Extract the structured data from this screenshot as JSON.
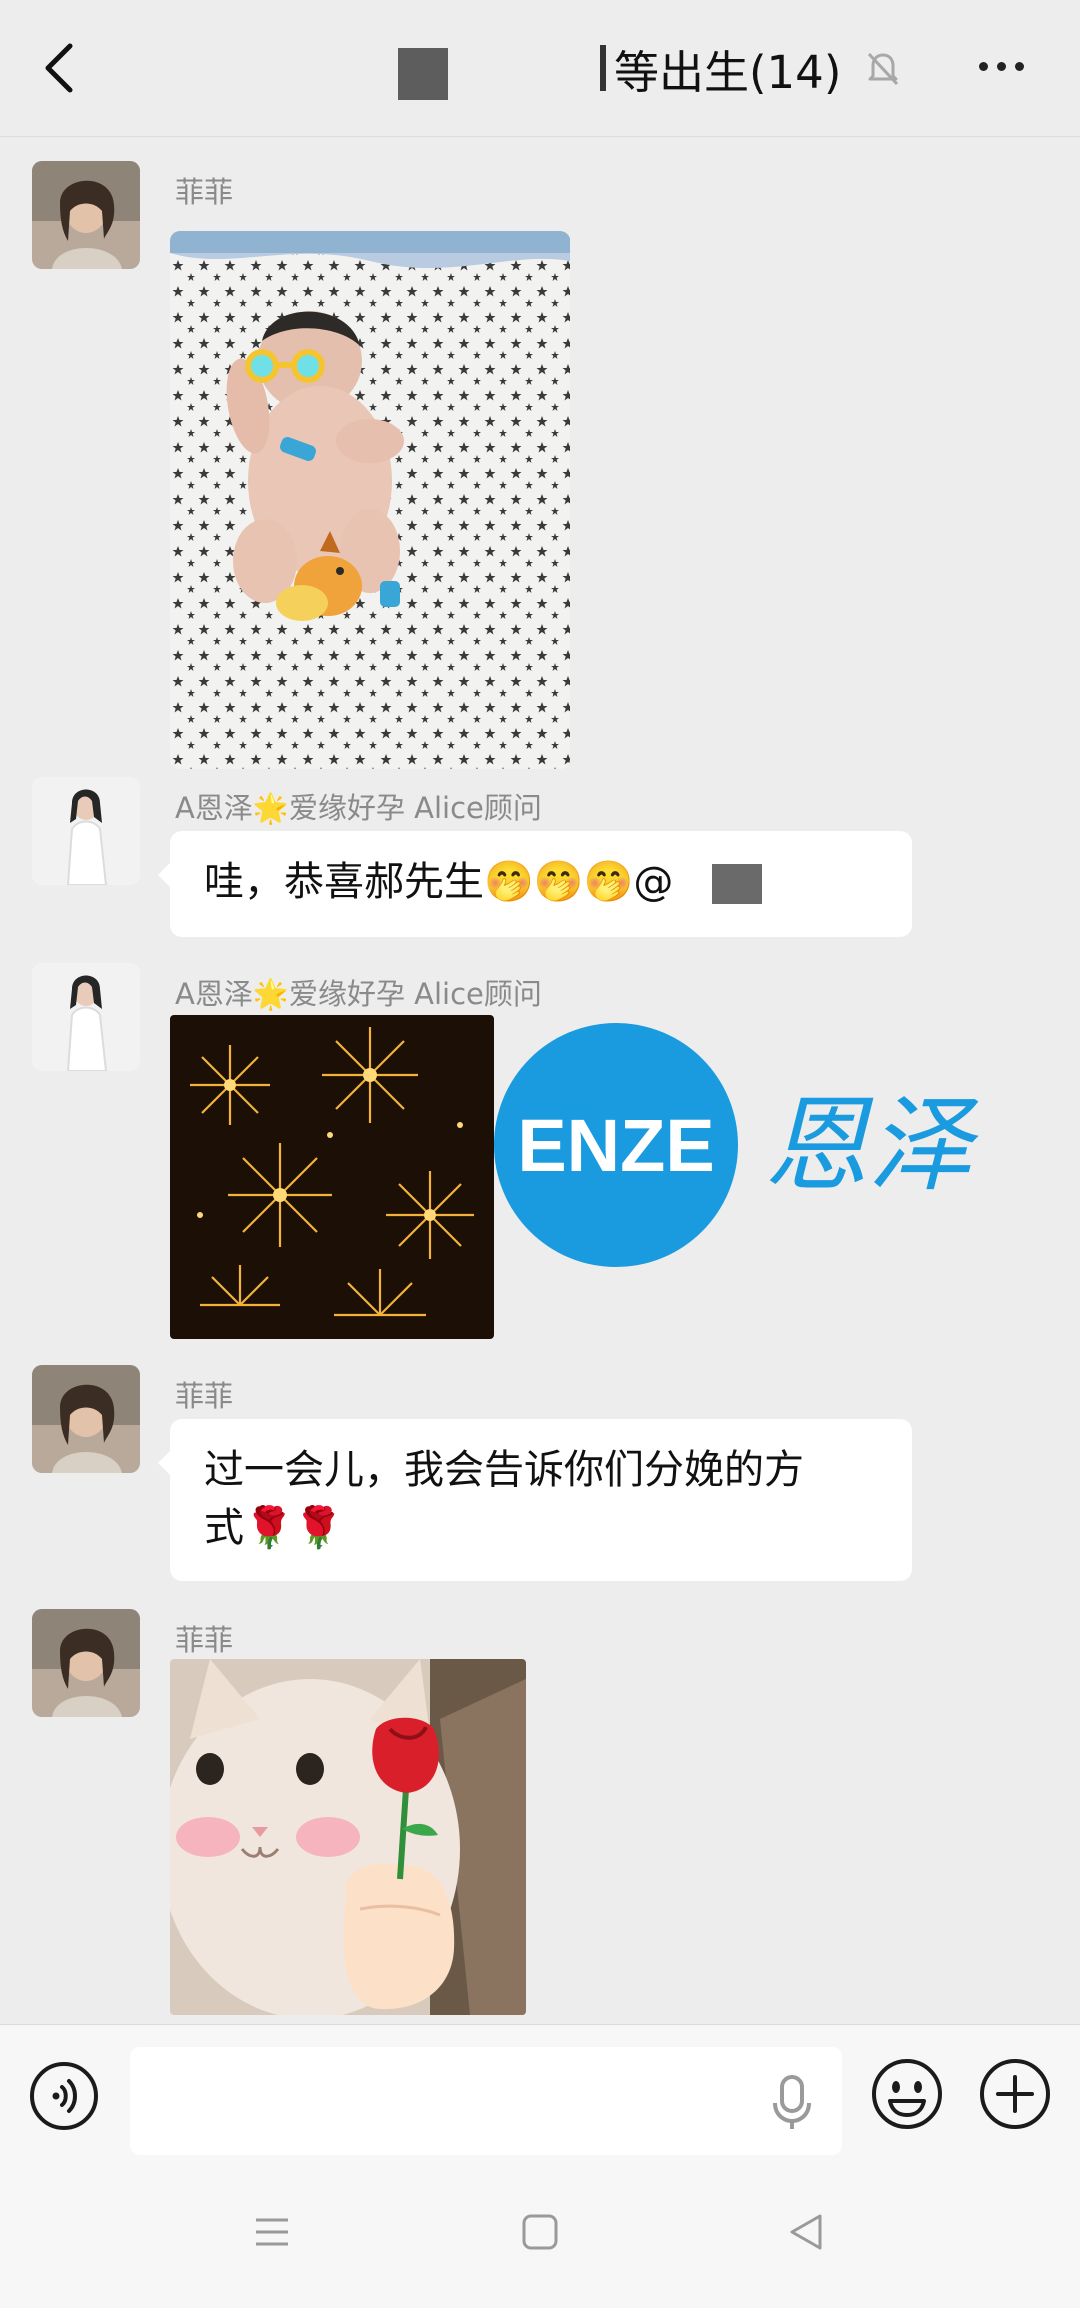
{
  "header": {
    "title": "等出生(14)"
  },
  "messages": [
    {
      "sender": "菲菲",
      "type": "image",
      "content": "baby photo"
    },
    {
      "sender": "A恩泽🌟爱缘好孕 Alice顾问",
      "type": "text",
      "text": "哇，恭喜郝先生🤭🤭🤭@"
    },
    {
      "sender": "A恩泽🌟爱缘好孕 Alice顾问",
      "type": "image",
      "content": "fireworks"
    },
    {
      "sender": "菲菲",
      "type": "text",
      "text_line1": "过一会儿，我会告诉你们分娩的方",
      "text_line2": "式🌹🌹"
    },
    {
      "sender": "菲菲",
      "type": "image",
      "content": "cat with rose sticker"
    }
  ],
  "watermark": {
    "badge": "ENZE",
    "chinese": "恩泽",
    "color": "#1a9be0"
  },
  "icons": {
    "back": "chevron-left-icon",
    "mute": "bell-off-icon",
    "more": "more-icon",
    "voice": "voice-icon",
    "mic": "mic-icon",
    "emoji": "emoji-icon",
    "plus": "plus-icon"
  }
}
